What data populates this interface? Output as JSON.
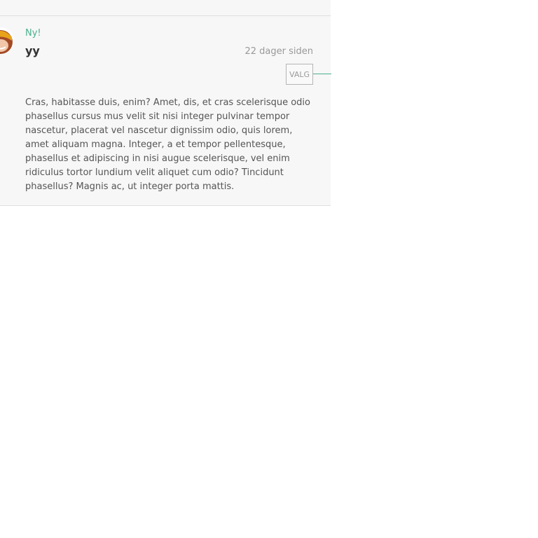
{
  "post": {
    "badge": "Ny!",
    "author": "yy",
    "timestamp": "22 dager siden",
    "options_label": "VALG",
    "body": "Cras, habitasse duis, enim? Amet, dis, et cras scelerisque odio phasellus cursus mus velit sit nisi integer pulvinar tempor nascetur, placerat vel nascetur dignissim odio, quis lorem, amet aliquam magna. Integer, a et tempor pellentesque, phasellus et adipiscing in nisi augue scelerisque, vel enim ridiculus tortor lundium velit aliquet cum odio? Tincidunt phasellus? Magnis ac, ut integer porta mattis."
  },
  "colors": {
    "accent": "#4caf8f",
    "card_background": "#f7f7f7",
    "avatar_hair": "#e8a31a",
    "avatar_skin": "#a34a25"
  },
  "icons": {
    "avatar": "user-avatar-icon"
  }
}
